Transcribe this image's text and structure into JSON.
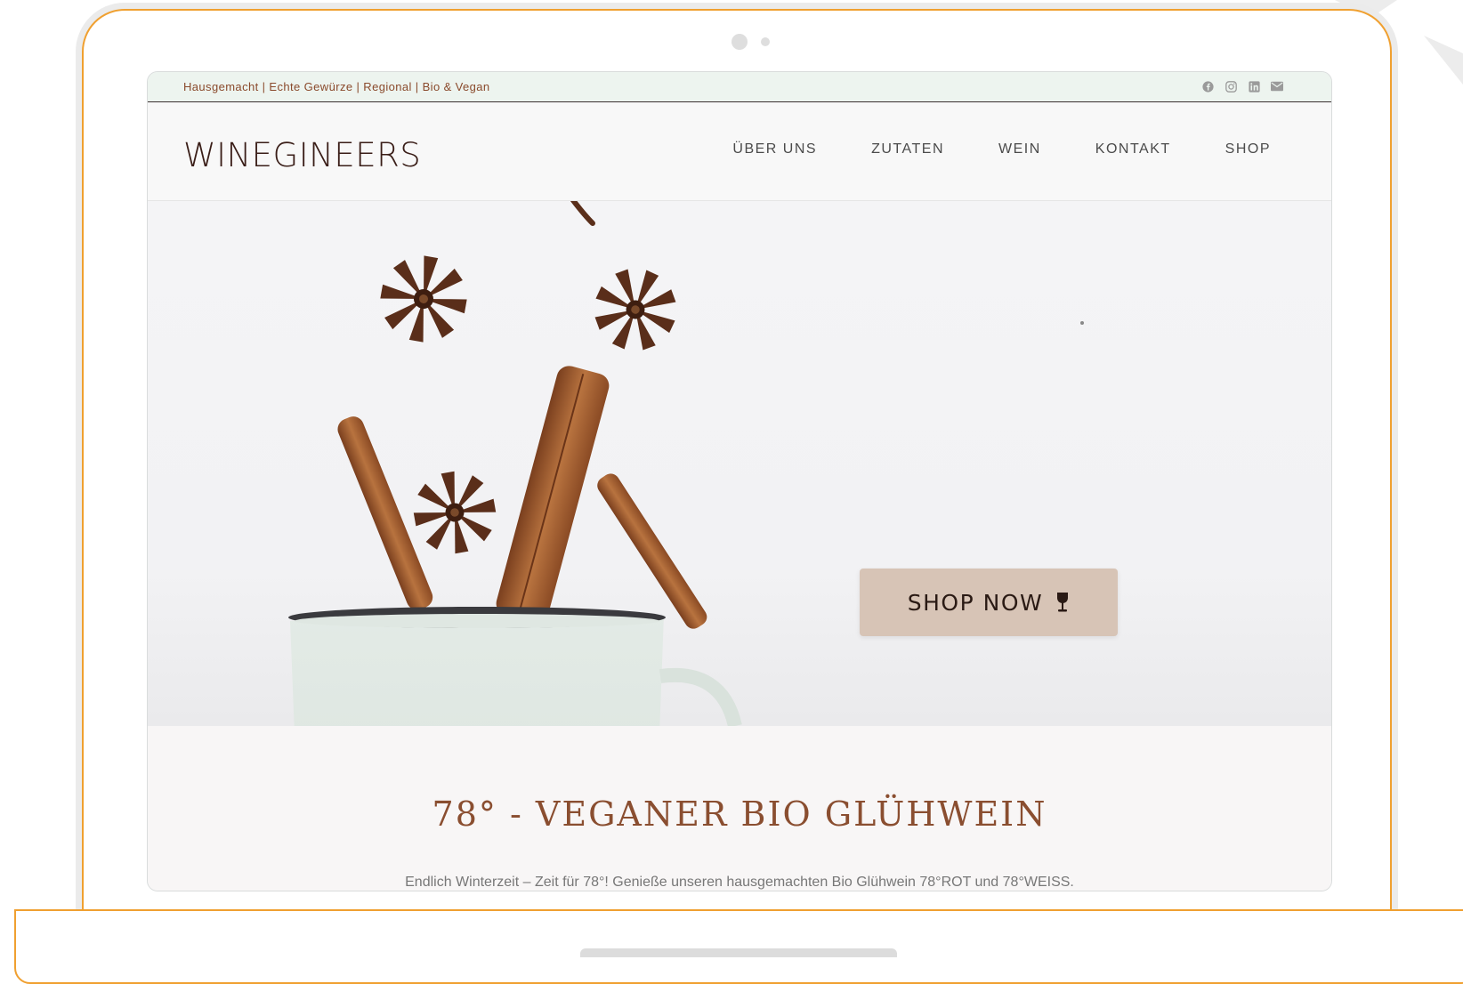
{
  "topbar": {
    "tagline": "Hausgemacht | Echte Gewürze | Regional | Bio & Vegan",
    "social_icons": [
      "facebook-icon",
      "instagram-icon",
      "linkedin-icon",
      "email-icon"
    ]
  },
  "header": {
    "logo": "WINEGINEERS",
    "nav": [
      "ÜBER UNS",
      "ZUTATEN",
      "WEIN",
      "KONTAKT",
      "SHOP"
    ]
  },
  "hero": {
    "cta_label": "SHOP NOW",
    "cta_icon": "wine-glass-icon"
  },
  "section": {
    "headline": "78° - VEGANER BIO GLÜHWEIN",
    "intro": "Endlich Winterzeit – Zeit für 78°! Genieße unseren hausgemachten Bio Glühwein 78°ROT und 78°WEISS."
  },
  "colors": {
    "frame_accent": "#f0a030",
    "topbar_bg": "#edf4ef",
    "tagline": "#8a4a2c",
    "button_bg": "#d7c4b6",
    "headline": "#8a4e30",
    "logo": "#3a1e18"
  }
}
